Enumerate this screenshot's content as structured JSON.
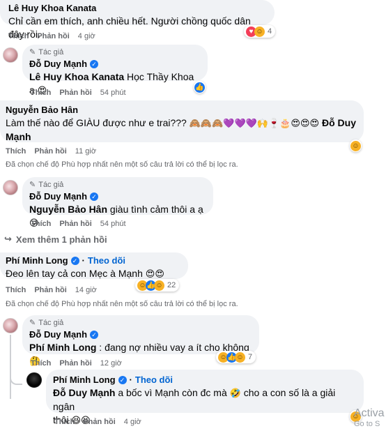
{
  "comments": [
    {
      "author": "Lê Huy Khoa Kanata",
      "text": "Chỉ cần em thích, anh chiều hết. Người chồng quốc dân đây rồi.",
      "like": "Thích",
      "reply": "Phản hồi",
      "time": "4 giờ",
      "reaction_count": "4"
    },
    {
      "badge": "Tác giả",
      "author": "Đỗ Duy Mạnh",
      "tag": "Lê Huy Khoa Kanata",
      "text": " Học Thầy Khoa ạ",
      "like": "Thích",
      "reply": "Phản hồi",
      "time": "54 phút"
    },
    {
      "author": "Nguyễn Bảo Hân",
      "text_line1": "Làm thế nào để GIÀU được như e trai??? ",
      "tag": "Đỗ Duy",
      "text_line2": "Mạnh",
      "like": "Thích",
      "reply": "Phản hồi",
      "time": "11 giờ"
    },
    {
      "badge": "Tác giả",
      "author": "Đỗ Duy Mạnh",
      "tag": "Nguyễn Bảo Hân",
      "text": " giàu tình cảm thôi a ạ",
      "like": "Thích",
      "reply": "Phản hồi",
      "time": "54 phút"
    },
    {
      "author": "Phí Minh Long",
      "follow": "Theo dõi",
      "text": "Đeo lên tay cả con Mẹc à Mạnh",
      "like": "Thích",
      "reply": "Phản hồi",
      "time": "14 giờ",
      "reaction_count": "22"
    },
    {
      "badge": "Tác giả",
      "author": "Đỗ Duy Mạnh",
      "tag": "Phí Minh Long",
      "text": " : đang nợ nhiều vay a ít cho không",
      "like": "Thích",
      "reply": "Phản hồi",
      "time": "12 giờ",
      "reaction_count": "7"
    },
    {
      "author": "Phí Minh Long",
      "follow": "Theo dõi",
      "tag": "Đỗ Duy Mạnh",
      "text_line1": " a bốc vì Mạnh còn đc mà ",
      "text_line1b": " cho a con số là a giải ngân",
      "text_line2": "thôi",
      "like": "Thích",
      "reply": "Phản hồi",
      "time": "4 giờ"
    }
  ],
  "filter_notice": "Đã chọn chế độ Phù hợp nhất nên một số câu trả lời có thể bị lọc ra.",
  "see_more": "Xem thêm 1 phản hồi",
  "watermark": {
    "line1": "Activa",
    "line2": "Go to S"
  },
  "icons": {
    "pencil": "pencil-icon",
    "verified": "verified-badge-icon",
    "reply_arrow": "reply-arrow-icon",
    "reactions": [
      "love",
      "haha",
      "like",
      "care"
    ]
  },
  "colors": {
    "bubble": "#f0f2f5",
    "muted": "#65676b",
    "link": "#0064d1",
    "verified": "#1877f2"
  }
}
